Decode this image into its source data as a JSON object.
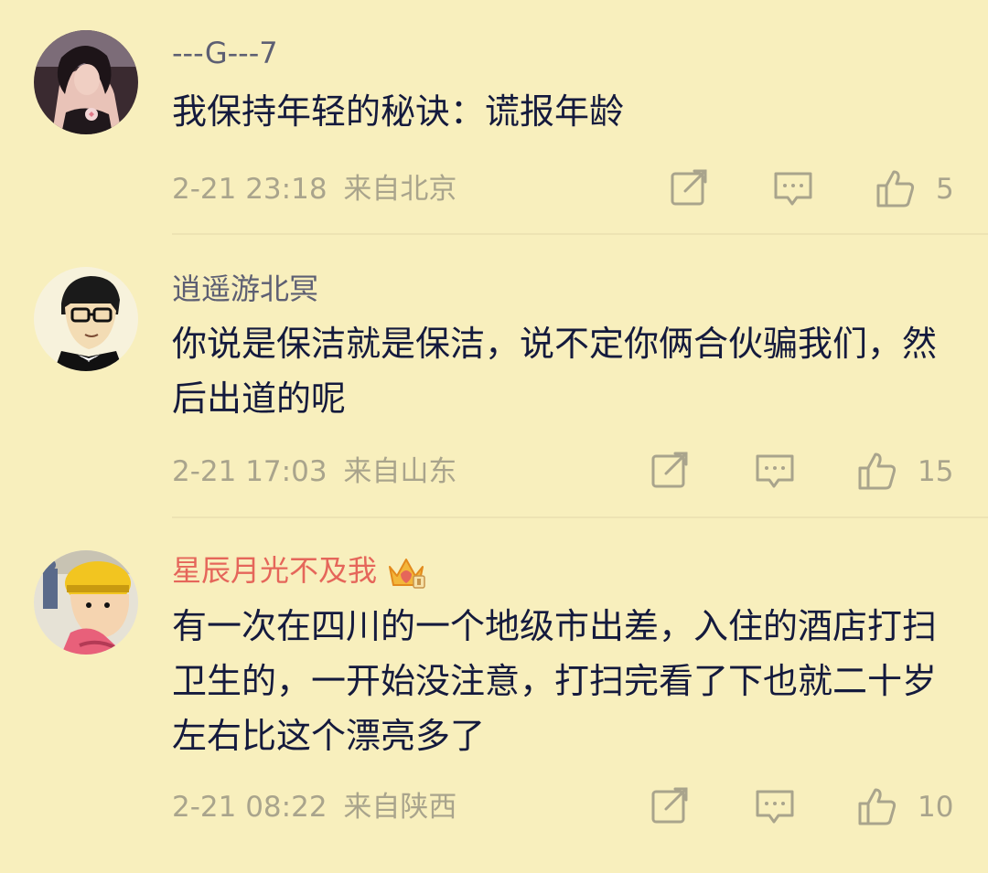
{
  "comments": [
    {
      "username": "---G---7",
      "text": "我保持年轻的秘诀：谎报年龄",
      "date": "2-21 23:18",
      "location": "来自北京",
      "likes": "5",
      "share_icon": "share-icon",
      "reply_icon": "comment-icon",
      "like_icon": "thumbs-up-icon"
    },
    {
      "username": "逍遥游北冥",
      "text": "你说是保洁就是保洁，说不定你俩合伙骗我们，然后出道的呢",
      "date": "2-21 17:03",
      "location": "来自山东",
      "likes": "15",
      "share_icon": "share-icon",
      "reply_icon": "comment-icon",
      "like_icon": "thumbs-up-icon"
    },
    {
      "username": "星辰月光不及我",
      "badge_icon": "crown-vip-icon",
      "text": "有一次在四川的一个地级市出差，入住的酒店打扫卫生的，一开始没注意，打扫完看了下也就二十岁左右比这个漂亮多了",
      "date": "2-21 08:22",
      "location": "来自陕西",
      "likes": "10",
      "share_icon": "share-icon",
      "reply_icon": "comment-icon",
      "like_icon": "thumbs-up-icon"
    }
  ],
  "colors": {
    "background": "#f8efbd",
    "text": "#141a3d",
    "username": "#5d5f73",
    "vip_username": "#e5665a",
    "meta": "#a9a48c"
  }
}
